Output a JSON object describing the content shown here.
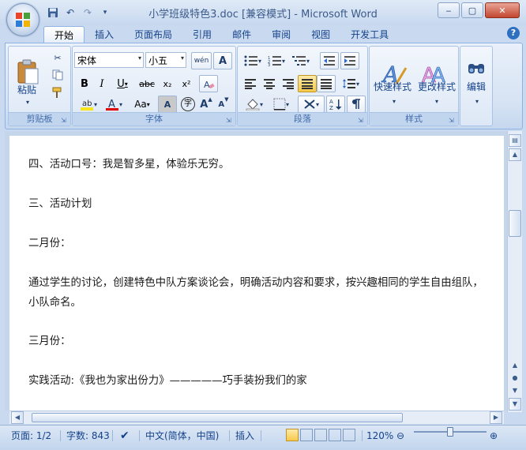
{
  "window": {
    "title": "小学班级特色3.doc [兼容模式] - Microsoft Word",
    "controls": {
      "minimize": "‒",
      "maximize": "▢",
      "close": "✕"
    }
  },
  "qat": [
    "save-icon",
    "undo-icon",
    "redo-icon",
    "customize-icon"
  ],
  "tabs": [
    {
      "label": "开始",
      "active": true
    },
    {
      "label": "插入"
    },
    {
      "label": "页面布局"
    },
    {
      "label": "引用"
    },
    {
      "label": "邮件"
    },
    {
      "label": "审阅"
    },
    {
      "label": "视图"
    },
    {
      "label": "开发工具"
    }
  ],
  "ribbon": {
    "clipboard": {
      "label": "剪贴板",
      "paste": "粘贴"
    },
    "font": {
      "label": "字体",
      "font_name": "宋体",
      "font_size": "小五",
      "bold": "B",
      "italic": "I",
      "underline": "U",
      "strikethrough": "abc",
      "subscript": "x₂",
      "superscript": "x²",
      "grow": "A",
      "shrink": "A",
      "clear_format": "A",
      "font_color": "A",
      "char_scale": "Aa",
      "char_shade": "A",
      "phonetic": "wén",
      "border": "A",
      "enclose": "字"
    },
    "paragraph": {
      "label": "段落"
    },
    "styles": {
      "label": "样式",
      "quick_styles": "快速样式",
      "change_styles": "更改样式"
    },
    "editing": {
      "label": "编辑"
    }
  },
  "document": {
    "paragraphs": [
      "四、活动口号：我是智多星，体验乐无穷。",
      "三、活动计划",
      "二月份：",
      "通过学生的讨论，创建特色中队方案谈论会，明确活动内容和要求，按兴趣相同的学生自由组队，",
      "小队命名。",
      "三月份：",
      "实践活动:《我也为家出份力》—————巧手装扮我们的家"
    ]
  },
  "statusbar": {
    "page": "页面: 1/2",
    "words": "字数: 843",
    "language": "中文(简体，中国)",
    "insert_mode": "插入",
    "zoom": "120%"
  },
  "colors": {
    "accent": "#15428b",
    "ribbon_bg": "#dbe7f6",
    "highlight": "#f7d25a",
    "font_color": "#e00000",
    "close_btn": "#c2472f"
  }
}
